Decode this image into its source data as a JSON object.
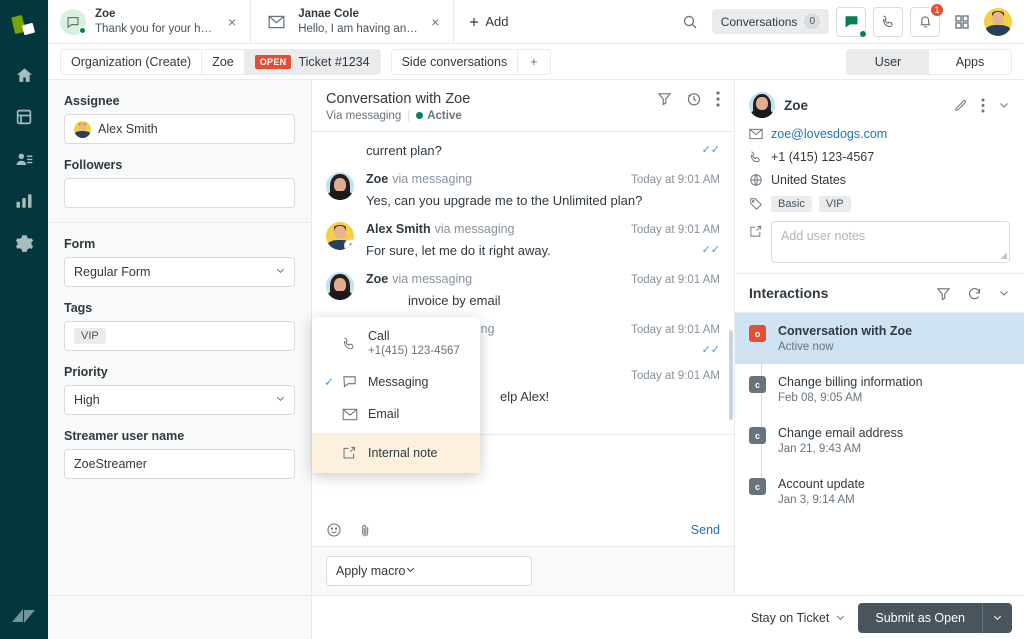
{
  "rail": {
    "logo": "zendesk-logo",
    "items": [
      {
        "name": "home-icon"
      },
      {
        "name": "views-icon"
      },
      {
        "name": "customers-icon"
      },
      {
        "name": "reporting-icon"
      },
      {
        "name": "settings-icon"
      }
    ],
    "footer_logo": "zendesk-mark"
  },
  "tabs": [
    {
      "title": "Zoe",
      "subtitle": "Thank you for your hel...",
      "icon": "chat-bubble-icon",
      "active": true,
      "close": "×"
    },
    {
      "title": "Janae Cole",
      "subtitle": "Hello, I am having an is...",
      "icon": "envelope-icon",
      "active": false,
      "close": "×"
    }
  ],
  "add_tab_label": "Add",
  "topbar": {
    "search_icon": "search-icon",
    "conversations_label": "Conversations",
    "conversations_count": "0",
    "chat_icon": "chat-icon",
    "call_icon": "phone-icon",
    "bell_icon": "bell-icon",
    "bell_badge": "1",
    "apps_grid_icon": "grid-icon",
    "avatar": "user-avatar"
  },
  "breadcrumbs": {
    "items": [
      {
        "label": "Organization (Create)",
        "active": false
      },
      {
        "label": "Zoe",
        "active": false
      },
      {
        "label": "Ticket #1234",
        "active": true,
        "badge": "OPEN"
      }
    ],
    "side_conversations": "Side conversations",
    "add": "+"
  },
  "view_toggle": {
    "options": [
      "User",
      "Apps"
    ],
    "selected": "User"
  },
  "form_panel": {
    "assignee_label": "Assignee",
    "assignee_value": "Alex Smith",
    "followers_label": "Followers",
    "followers_value": "",
    "form_label": "Form",
    "form_value": "Regular Form",
    "tags_label": "Tags",
    "tags": [
      "VIP"
    ],
    "priority_label": "Priority",
    "priority_value": "High",
    "streamer_label": "Streamer user name",
    "streamer_value": "ZoeStreamer"
  },
  "conversation": {
    "title": "Conversation with Zoe",
    "via": "Via messaging",
    "status": "Active",
    "filter_icon": "filter-icon",
    "history_icon": "history-icon",
    "more_icon": "more-vertical-icon",
    "messages": [
      {
        "partial": true,
        "text": "current plan?",
        "ticks": true
      },
      {
        "author": "Zoe",
        "via": "via messaging",
        "time": "Today at 9:01 AM",
        "text": "Yes, can you upgrade me to the Unlimited plan?",
        "avatar": "woman",
        "ticks": false
      },
      {
        "author": "Alex Smith",
        "via": "via messaging",
        "time": "Today at 9:01 AM",
        "text": "For sure, let me do it right away.",
        "avatar": "man",
        "agent": true,
        "ticks": true
      },
      {
        "author": "Zoe",
        "via": "via messaging",
        "time": "Today at 9:01 AM",
        "text": "invoice by email",
        "avatar": "woman",
        "ticks": false
      },
      {
        "author": "",
        "via": "aging",
        "time": "Today at 9:01 AM",
        "text": "",
        "ticks": true
      },
      {
        "author": "",
        "via": "",
        "time": "Today at 9:01 AM",
        "text": "elp Alex!",
        "ticks": false
      }
    ]
  },
  "channel_dropdown": {
    "items": [
      {
        "label": "Call",
        "sub": "+1(415) 123-4567",
        "icon": "phone-icon",
        "checked": false,
        "highlight": false
      },
      {
        "label": "Messaging",
        "sub": "",
        "icon": "chat-bubble-icon",
        "checked": true,
        "highlight": false
      },
      {
        "label": "Email",
        "sub": "",
        "icon": "envelope-icon",
        "checked": false,
        "highlight": false
      },
      {
        "label": "Internal note",
        "sub": "",
        "icon": "note-edit-icon",
        "checked": false,
        "highlight": true
      }
    ]
  },
  "composer": {
    "channel": "Messaging",
    "emoji_icon": "emoji-icon",
    "attach_icon": "paperclip-icon",
    "send_label": "Send",
    "macro_placeholder": "Apply macro"
  },
  "user_panel": {
    "name": "Zoe",
    "edit_icon": "pencil-icon",
    "more_icon": "more-vertical-icon",
    "collapse_icon": "chevron-down-icon",
    "email": "zoe@lovesdogs.com",
    "phone": "+1 (415) 123-4567",
    "country": "United States",
    "tags": [
      "Basic",
      "VIP"
    ],
    "notes_placeholder": "Add user notes"
  },
  "interactions": {
    "title": "Interactions",
    "filter_icon": "filter-icon",
    "refresh_icon": "refresh-icon",
    "collapse_icon": "chevron-down-icon",
    "items": [
      {
        "badge": "o",
        "badge_color": "#e34f32",
        "title": "Conversation with Zoe",
        "sub": "Active now",
        "selected": true
      },
      {
        "badge": "c",
        "badge_color": "#68737d",
        "title": "Change billing information",
        "sub": "Feb 08, 9:05 AM",
        "selected": false
      },
      {
        "badge": "c",
        "badge_color": "#68737d",
        "title": "Change email address",
        "sub": "Jan 21, 9:43 AM",
        "selected": false
      },
      {
        "badge": "c",
        "badge_color": "#68737d",
        "title": "Account update",
        "sub": "Jan 3, 9:14 AM",
        "selected": false
      }
    ]
  },
  "bottombar": {
    "stay_label": "Stay on Ticket",
    "submit_label": "Submit as Open",
    "submit_arrow_icon": "chevron-down-icon"
  },
  "colors": {
    "rail_bg": "#03363d",
    "accent_green": "#78a300",
    "open_red": "#e34f32",
    "link_blue": "#1f73b7",
    "selected_blue": "#cee2f2",
    "note_peach": "#fdf0dc",
    "submit_gray": "#49545c"
  }
}
